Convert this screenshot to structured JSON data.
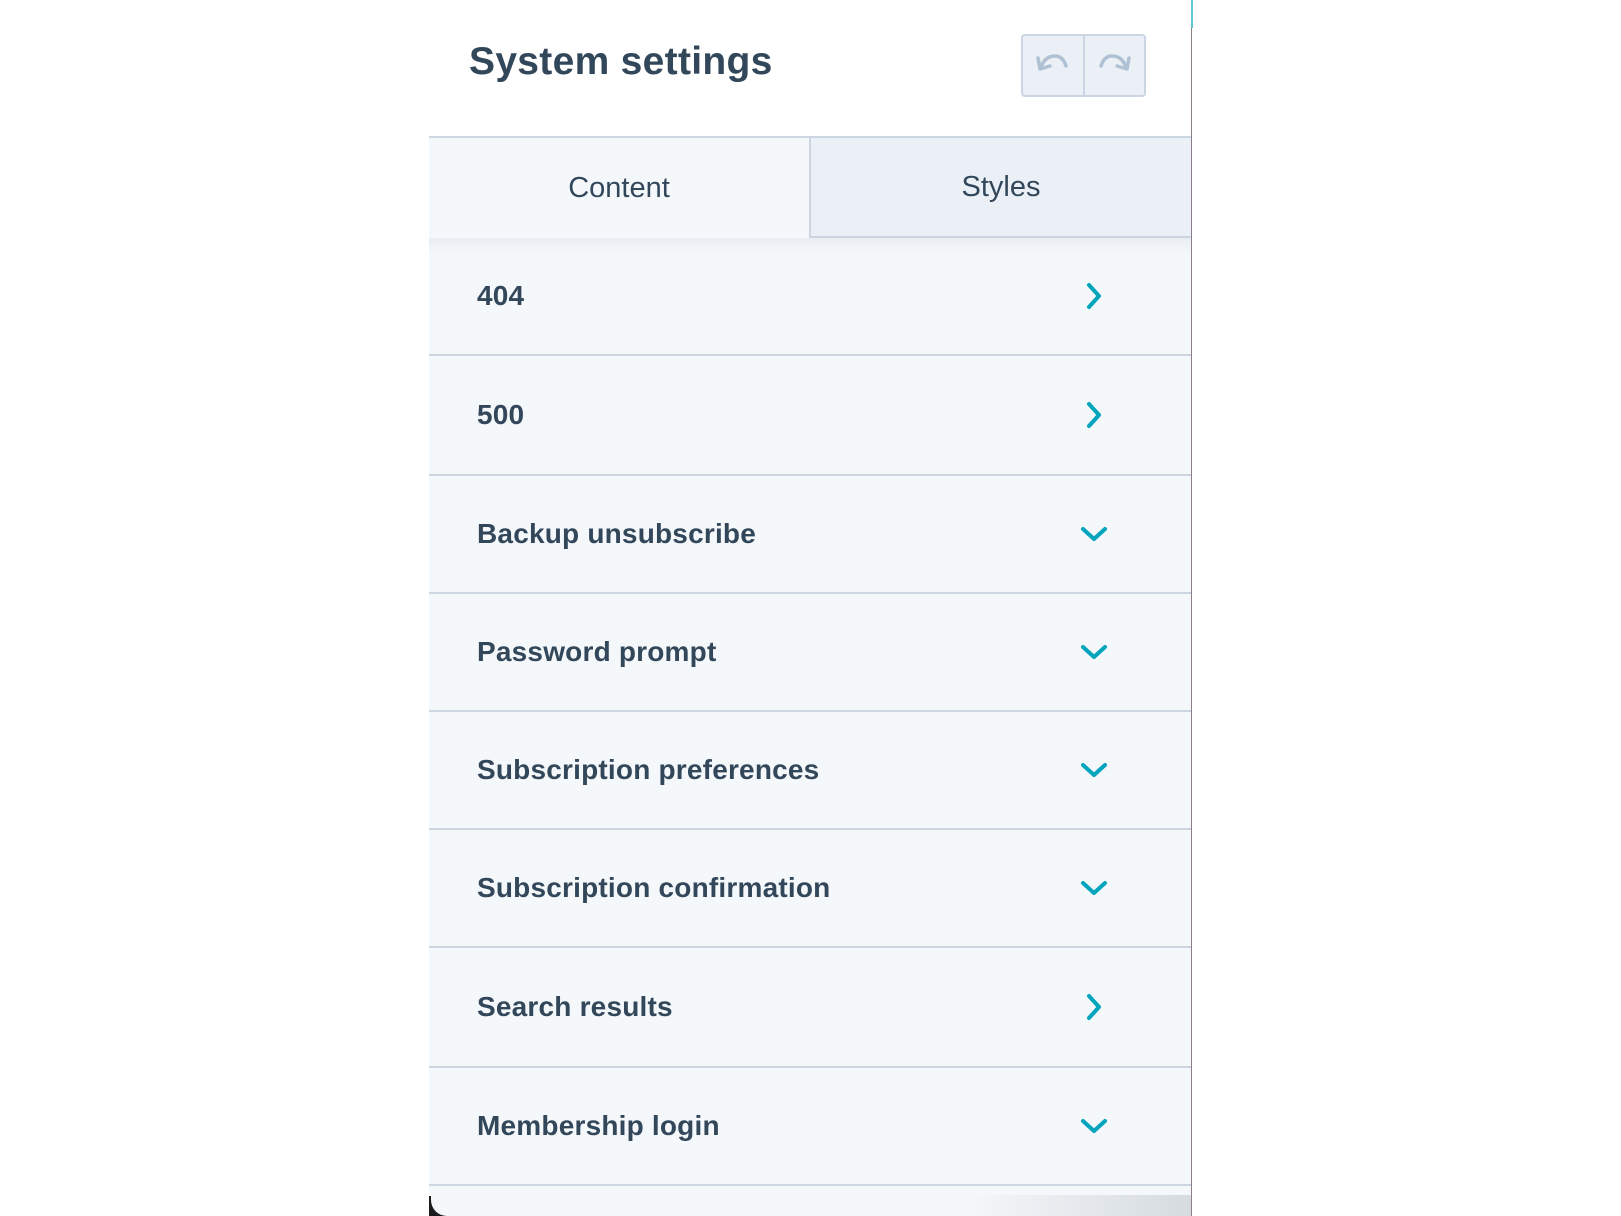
{
  "header": {
    "title": "System settings",
    "undo_icon": "undo-icon",
    "redo_icon": "redo-icon"
  },
  "tabs": [
    {
      "label": "Content",
      "active": true
    },
    {
      "label": "Styles",
      "active": false
    }
  ],
  "items": [
    {
      "label": "404",
      "icon": "chevron-right-icon"
    },
    {
      "label": "500",
      "icon": "chevron-right-icon"
    },
    {
      "label": "Backup unsubscribe",
      "icon": "chevron-down-icon"
    },
    {
      "label": "Password prompt",
      "icon": "chevron-down-icon"
    },
    {
      "label": "Subscription preferences",
      "icon": "chevron-down-icon"
    },
    {
      "label": "Subscription confirmation",
      "icon": "chevron-down-icon"
    },
    {
      "label": "Search results",
      "icon": "chevron-right-icon"
    },
    {
      "label": "Membership login",
      "icon": "chevron-down-icon"
    }
  ],
  "colors": {
    "text": "#33475b",
    "accent": "#00a4bd",
    "border": "#cbd6e2",
    "panel_bg": "#f5f8fa",
    "inactive_tab_bg": "#eaf0f6"
  }
}
